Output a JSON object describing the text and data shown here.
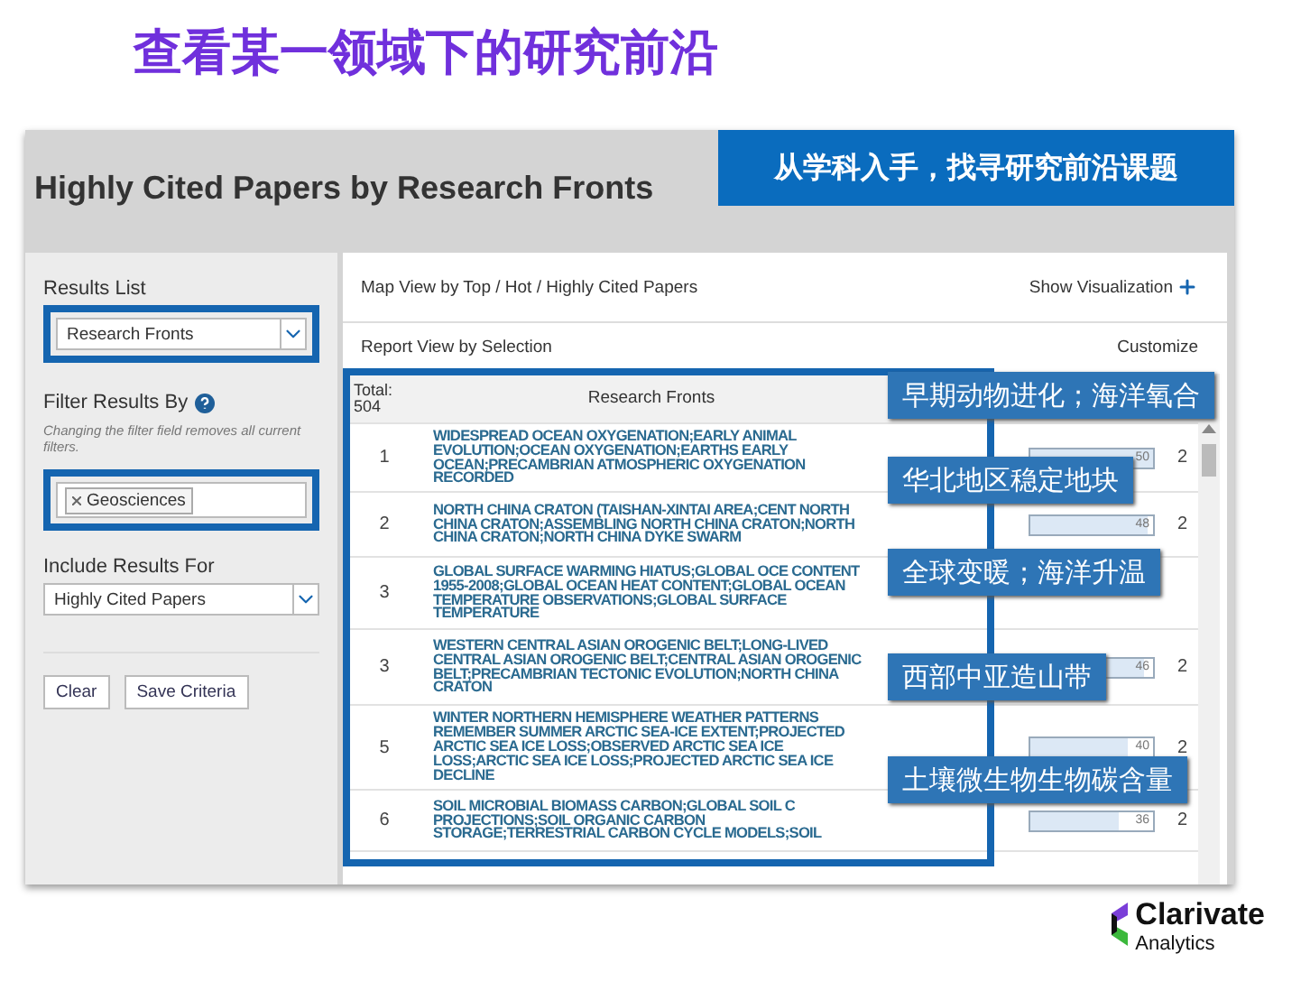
{
  "heading": "查看某一领域下的研究前沿",
  "report": {
    "title": "Highly Cited Papers by Research Fronts",
    "banner": "从学科入手，找寻研究前沿课题"
  },
  "sidebar": {
    "results_list": {
      "label": "Results List",
      "value": "Research Fronts"
    },
    "filter": {
      "label": "Filter Results By",
      "hint": "Changing the filter field removes all current filters.",
      "tags": [
        "Geosciences"
      ]
    },
    "include": {
      "label": "Include Results For",
      "value": "Highly Cited Papers"
    },
    "buttons": [
      "Clear",
      "Save Criteria"
    ]
  },
  "main": {
    "map_view": "Map View by Top / Hot / Highly Cited Papers",
    "show_visualization": "Show Visualization",
    "report_view": "Report View by Selection",
    "customize": "Customize"
  },
  "table": {
    "total_label": "Total:",
    "total": "504",
    "header": "Research Fronts",
    "rows": [
      {
        "rank": "1",
        "title": "WIDESPREAD OCEAN OXYGENATION;EARLY ANIMAL EVOLUTION;OCEAN OXYGENATION;EARTHS EARLY OCEAN;PRECAMBRIAN ATMOSPHERIC OXYGENATION RECORDED",
        "level": 1,
        "value": "50",
        "column_4": "2"
      },
      {
        "rank": "2",
        "title": "NORTH CHINA CRATON (TAISHAN-XINTAI AREA;CENT NORTH CHINA CRATON;ASSEMBLING NORTH CHINA CRATON;NORTH CHINA CRATON;NORTH CHINA DYKE SWARM",
        "level": 0.96,
        "value": "48",
        "column_4": "2"
      },
      {
        "rank": "3",
        "title": "GLOBAL SURFACE WARMING HIATUS;GLOBAL OCE CONTENT 1955-2008;GLOBAL OCEAN HEAT CONTENT;GLOBAL OCEAN TEMPERATURE OBSERVATIONS;GLOBAL SURFACE TEMPERATURE"
      },
      {
        "rank": "3",
        "title": "WESTERN CENTRAL ASIAN OROGENIC BELT;LONG-LIVED CENTRAL ASIAN OROGENIC BELT;CENTRAL ASIAN OROGENIC BELT;PRECAMBRIAN TECTONIC EVOLUTION;NORTH CHINA CRATON",
        "level": 0.92,
        "value": "46",
        "column_4": "2"
      },
      {
        "rank": "5",
        "title": "WINTER NORTHERN HEMISPHERE WEATHER PATTERNS REMEMBER SUMMER ARCTIC SEA-ICE EXTENT;PROJECTED ARCTIC SEA ICE LOSS;OBSERVED ARCTIC SEA ICE LOSS;ARCTIC SEA ICE LOSS;PROJECTED ARCTIC SEA ICE DECLINE",
        "level": 0.8,
        "value": "40",
        "column_4": "2"
      },
      {
        "rank": "6",
        "title": "SOIL MICROBIAL BIOMASS CARBON;GLOBAL SOIL C PROJECTIONS;SOIL ORGANIC CARBON STORAGE;TERRESTRIAL CARBON CYCLE MODELS;SOIL",
        "level": 0.72,
        "value": "36",
        "column_4": "2"
      }
    ]
  },
  "callouts": [
    "早期动物进化；海洋氧合",
    "华北地区稳定地块",
    "全球变暖；海洋升温",
    "西部中亚造山带",
    "土壤微生物生物碳含量"
  ],
  "logo": {
    "name": "Clarivate",
    "sub": "Analytics"
  }
}
